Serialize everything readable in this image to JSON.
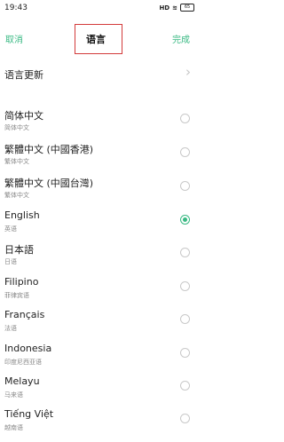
{
  "status": {
    "time": "19:43",
    "hd": "HD",
    "battery": "65"
  },
  "header": {
    "cancel_label": "取消",
    "title": "语言",
    "done_label": "完成"
  },
  "update": {
    "label": "语言更新",
    "chevron": "›"
  },
  "languages": [
    {
      "name": "简体中文",
      "sub": "简体中文",
      "selected": false
    },
    {
      "name": "繁體中文 (中國香港)",
      "sub": "繁体中文",
      "selected": false
    },
    {
      "name": "繁體中文 (中國台灣)",
      "sub": "繁体中文",
      "selected": false
    },
    {
      "name": "English",
      "sub": "英语",
      "selected": true
    },
    {
      "name": "日本語",
      "sub": "日语",
      "selected": false
    },
    {
      "name": "Filipino",
      "sub": "菲律宾语",
      "selected": false
    },
    {
      "name": "Français",
      "sub": "法语",
      "selected": false
    },
    {
      "name": "Indonesia",
      "sub": "印度尼西亚语",
      "selected": false
    },
    {
      "name": "Melayu",
      "sub": "马来语",
      "selected": false
    },
    {
      "name": "Tiếng Việt",
      "sub": "越南语",
      "selected": false
    }
  ],
  "colors": {
    "accent": "#39b983",
    "title_box_border": "#d33a3a"
  }
}
